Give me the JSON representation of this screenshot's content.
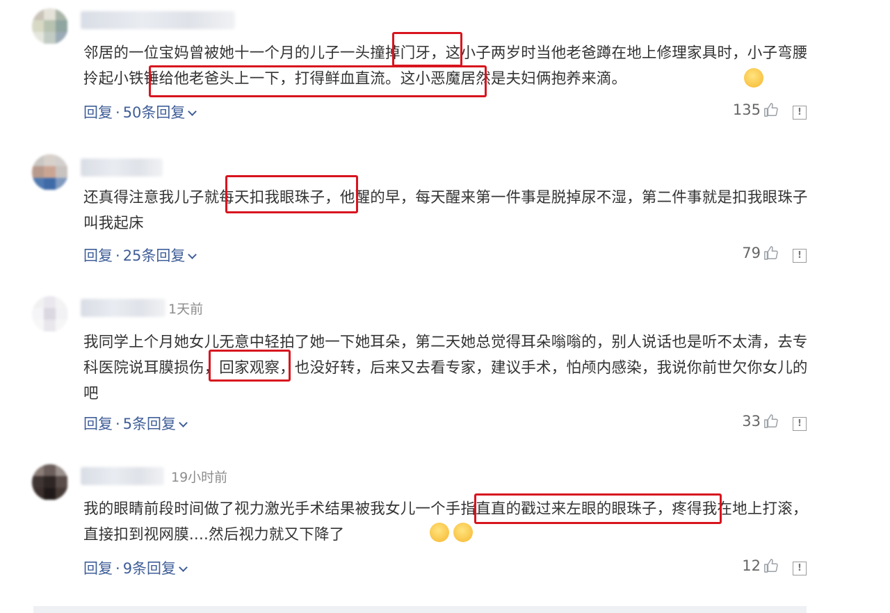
{
  "comments": [
    {
      "time": "",
      "text": "邻居的一位宝妈曾被她十一个月的儿子一头撞掉门牙，这小子两岁时当他老爸蹲在地上修理家具时，小子弯腰拎起小铁锤给他老爸头上一下，打得鲜血直流。这小恶魔居然是夫妇俩抱养来滴。",
      "reply_label": "回复",
      "reply_count": "50条回复",
      "likes": "135"
    },
    {
      "time": "",
      "text": "还真得注意我儿子就每天扣我眼珠子，他醒的早，每天醒来第一件事是脱掉尿不湿，第二件事就是扣我眼珠子叫我起床",
      "reply_label": "回复",
      "reply_count": "25条回复",
      "likes": "79"
    },
    {
      "time": "1天前",
      "text": "我同学上个月她女儿无意中轻拍了她一下她耳朵，第二天她总觉得耳朵嗡嗡的，别人说话也是听不太清，去专科医院说耳膜损伤，回家观察，也没好转，后来又去看专家，建议手术，怕颅内感染，我说你前世欠你女儿的吧",
      "reply_label": "回复",
      "reply_count": "5条回复",
      "likes": "33"
    },
    {
      "time": "19小时前",
      "text": "我的眼睛前段时间做了视力激光手术结果被我女儿一个手指直直的戳过来左眼的眼珠子，疼得我在地上打滚，直接扣到视网膜....然后视力就又下降了",
      "reply_label": "回复",
      "reply_count": "9条回复",
      "likes": "12"
    }
  ],
  "ui": {
    "dot": "·",
    "report_symbol": "!",
    "highlight_color": "#d8141e",
    "link_color": "#3f5e98"
  }
}
